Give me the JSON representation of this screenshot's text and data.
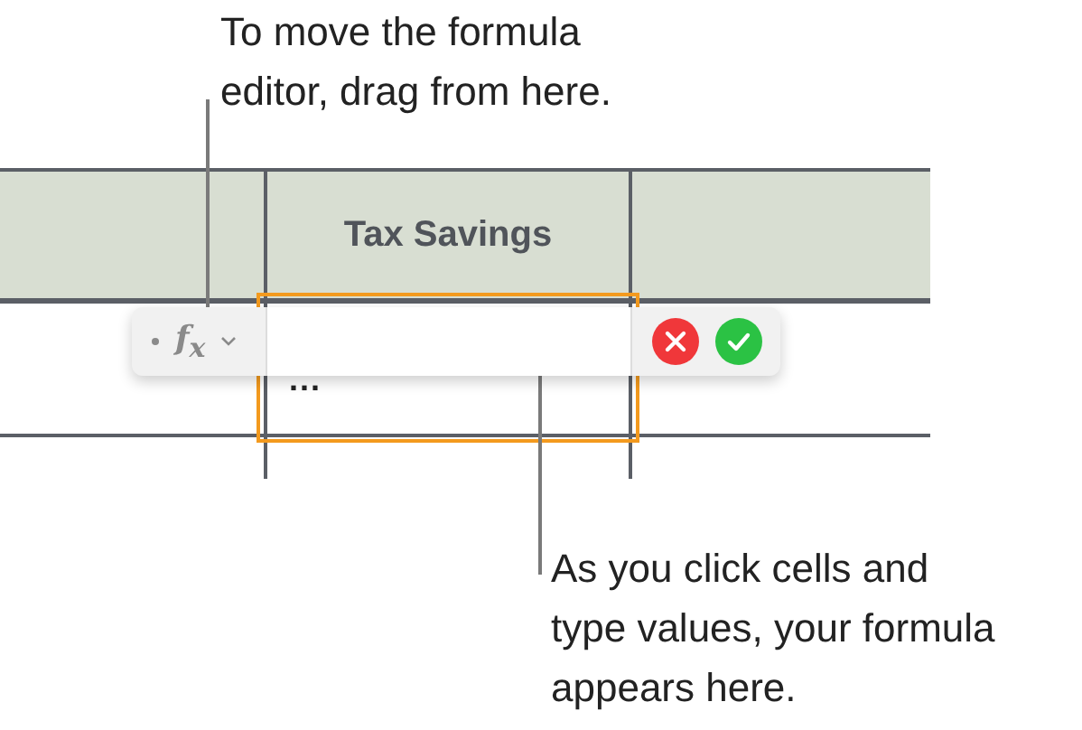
{
  "callouts": [
    {
      "text": "To move the formula editor, drag from here."
    },
    {
      "text": "As you click cells and type values, your formula appears here."
    }
  ],
  "table": {
    "header": "Tax Savings",
    "cell": "..."
  },
  "formula_editor": {
    "symbol": "f$_{x}$"
  }
}
